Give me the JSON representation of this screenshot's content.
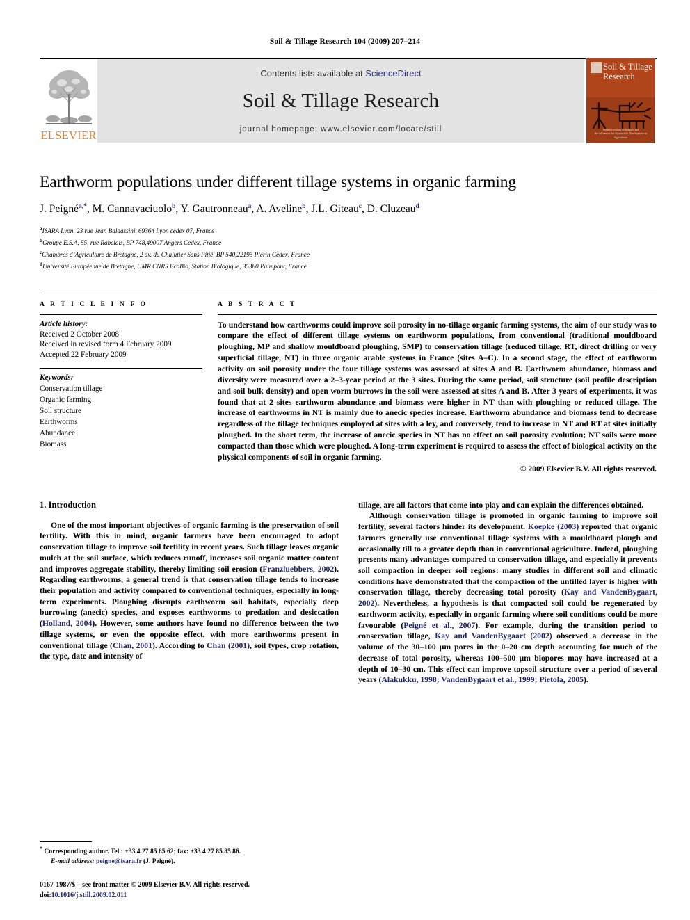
{
  "runhead": "Soil & Tillage Research 104 (2009) 207–214",
  "banner": {
    "publisher_logo": "elsevier-tree-logo",
    "publisher_name": "ELSEVIER",
    "contents_prefix": "Contents lists available at ",
    "contents_link": "ScienceDirect",
    "journal_title": "Soil & Tillage Research",
    "homepage": "journal homepage: www.elsevier.com/locate/still",
    "cover": {
      "title_line1": "Soil & Tillage",
      "title_line2": "Research",
      "footer_line1": "Troubleshooting techniques and",
      "footer_line2": "the influences for Sustainable Development in Agriculture",
      "accent": "#b1461d"
    }
  },
  "article": {
    "title": "Earthworm populations under different tillage systems in organic farming",
    "authors": [
      {
        "name": "J. Peigné",
        "marks": "a,*"
      },
      {
        "name": "M. Cannavaciuolo",
        "marks": "b"
      },
      {
        "name": "Y. Gautronneau",
        "marks": "a"
      },
      {
        "name": "A. Aveline",
        "marks": "b"
      },
      {
        "name": "J.L. Giteau",
        "marks": "c"
      },
      {
        "name": "D. Cluzeau",
        "marks": "d"
      }
    ],
    "affiliations": [
      {
        "mark": "a",
        "text": "ISARA Lyon, 23 rue Jean Baldassini, 69364 Lyon cedex 07, France"
      },
      {
        "mark": "b",
        "text": "Groupe E.S.A, 55, rue Rabelais, BP 748,49007 Angers Cedex, France"
      },
      {
        "mark": "c",
        "text": "Chambres d’Agriculture de Bretagne, 2 av. du Chalutier Sans Pitié, BP 540,22195 Plérin Cedex, France"
      },
      {
        "mark": "d",
        "text": "Université Européenne de Bretagne, UMR CNRS EcoBio, Station Biologique, 35380 Paimpont, France"
      }
    ]
  },
  "info": {
    "heading": "A R T I C L E   I N F O",
    "history_label": "Article history:",
    "history": [
      "Received 2 October 2008",
      "Received in revised form 4 February 2009",
      "Accepted 22 February 2009"
    ],
    "keywords_label": "Keywords:",
    "keywords": [
      "Conservation tillage",
      "Organic farming",
      "Soil structure",
      "Earthworms",
      "Abundance",
      "Biomass"
    ]
  },
  "abstract": {
    "heading": "A B S T R A C T",
    "text": "To understand how earthworms could improve soil porosity in no-tillage organic farming systems, the aim of our study was to compare the effect of different tillage systems on earthworm populations, from conventional (traditional mouldboard ploughing, MP and shallow mouldboard ploughing, SMP) to conservation tillage (reduced tillage, RT, direct drilling or very superficial tillage, NT) in three organic arable systems in France (sites A–C). In a second stage, the effect of earthworm activity on soil porosity under the four tillage systems was assessed at sites A and B. Earthworm abundance, biomass and diversity were measured over a 2–3-year period at the 3 sites. During the same period, soil structure (soil profile description and soil bulk density) and open worm burrows in the soil were assessed at sites A and B. After 3 years of experiments, it was found that at 2 sites earthworm abundance and biomass were higher in NT than with ploughing or reduced tillage. The increase of earthworms in NT is mainly due to anecic species increase. Earthworm abundance and biomass tend to decrease regardless of the tillage techniques employed at sites with a ley, and conversely, tend to increase in NT and RT at sites initially ploughed. In the short term, the increase of anecic species in NT has no effect on soil porosity evolution; NT soils were more compacted than those which were ploughed. A long-term experiment is required to assess the effect of biological activity on the physical components of soil in organic farming.",
    "copyright": "© 2009 Elsevier B.V. All rights reserved."
  },
  "body": {
    "section_number_title": "1. Introduction",
    "left_paragraph_1_a": "One of the most important objectives of organic farming is the preservation of soil fertility. With this in mind, organic farmers have been encouraged to adopt conservation tillage to improve soil fertility in recent years. Such tillage leaves organic mulch at the soil surface, which reduces runoff, increases soil organic matter content and improves aggregate stability, thereby limiting soil erosion (",
    "cite_franzluebbers": "Franzluebbers, 2002",
    "left_paragraph_1_b": "). Regarding earthworms, a general trend is that conservation tillage tends to increase their population and activity compared to conventional techniques, especially in long-term experiments. Ploughing disrupts earthworm soil habitats, especially deep burrowing (anecic) species, and exposes earthworms to predation and desiccation (",
    "cite_holland": "Holland, 2004",
    "left_paragraph_1_c": "). However, some authors have found no difference between the two tillage systems, or even the opposite effect, with more earthworms present in conventional tillage (",
    "cite_chan1": "Chan, 2001",
    "left_paragraph_1_d": "). According to ",
    "cite_chan2": "Chan (2001)",
    "left_paragraph_1_e": ", soil types, crop rotation, the type, date and intensity of ",
    "right_paragraph_1_cont": "tillage, are all factors that come into play and can explain the differences obtained.",
    "right_paragraph_2_a": "Although conservation tillage is promoted in organic farming to improve soil fertility, several factors hinder its development. ",
    "cite_koepke": "Koepke (2003)",
    "right_paragraph_2_b": " reported that organic farmers generally use conventional tillage systems with a mouldboard plough and occasionally till to a greater depth than in conventional agriculture. Indeed, ploughing presents many advantages compared to conservation tillage, and especially it prevents soil compaction in deeper soil regions: many studies in different soil and climatic conditions have demonstrated that the compaction of the untilled layer is higher with conservation tillage, thereby decreasing total porosity (",
    "cite_kay1": "Kay and VandenBygaart, 2002",
    "right_paragraph_2_c": "). Nevertheless, a hypothesis is that compacted soil could be regenerated by earthworm activity, especially in organic farming where soil conditions could be more favourable (",
    "cite_peigne": "Peigné et al., 2007",
    "right_paragraph_2_d": "). For example, during the transition period to conservation tillage, ",
    "cite_kay2": "Kay and VandenBygaart (2002)",
    "right_paragraph_2_e": " observed a decrease in the volume of the 30–100 μm pores in the 0–20 cm depth accounting for much of the decrease of total porosity, whereas 100–500 μm biopores may have increased at a depth of 10–30 cm. This effect can improve topsoil structure over a period of several years (",
    "cite_alakukku": "Alakukku, 1998; VandenBygaart et al., 1999; Pietola, 2005",
    "right_paragraph_2_f": ")."
  },
  "footnotes": {
    "corresponding_marker": "*",
    "corresponding": " Corresponding author. Tel.: +33 4 27 85 85 62; fax: +33 4 27 85 85 86.",
    "email_label": "E-mail address:",
    "email": "peigne@isara.fr",
    "email_suffix": " (J. Peigné).",
    "frontmatter": "0167-1987/$ – see front matter © 2009 Elsevier B.V. All rights reserved.",
    "doi_label": "doi:",
    "doi": "10.1016/j.still.2009.02.011"
  }
}
